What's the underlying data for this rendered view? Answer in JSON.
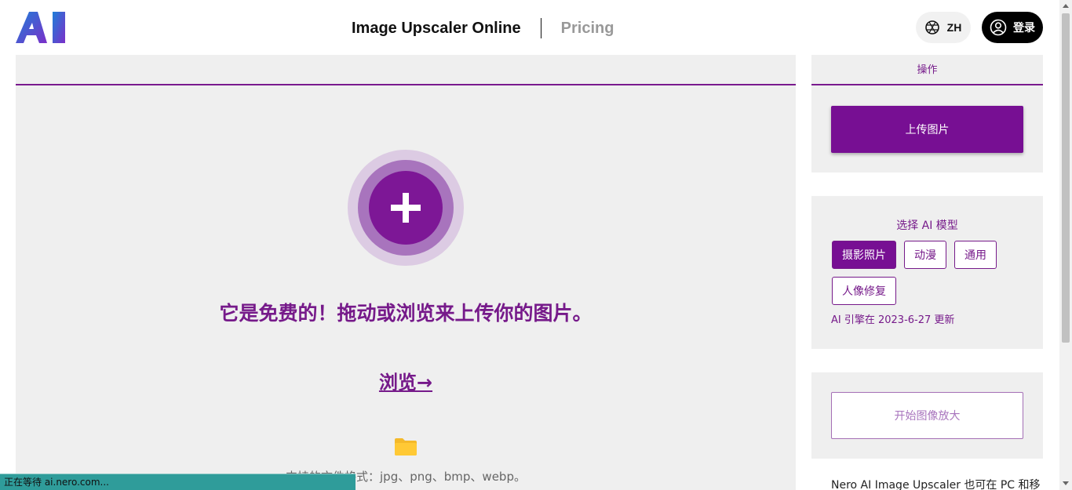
{
  "header": {
    "logo_text": "AI",
    "nav": [
      {
        "label": "Image Upscaler Online"
      },
      {
        "label": "Pricing"
      }
    ],
    "lang_label": "ZH",
    "login_label": "登录"
  },
  "main": {
    "headline": "它是免费的！拖动或浏览来上传你的图片。",
    "browse_label": "浏览→",
    "formats_text": "支持的文件格式：jpg、png、bmp、webp。"
  },
  "sidebar": {
    "actions_title": "操作",
    "upload_label": "上传图片",
    "model_title": "选择 AI 模型",
    "models": [
      {
        "label": "摄影照片",
        "active": true
      },
      {
        "label": "动漫",
        "active": false
      },
      {
        "label": "通用",
        "active": false
      },
      {
        "label": "人像修复",
        "active": false
      }
    ],
    "engine_note": "AI 引擎在 2023-6-27 更新",
    "start_label": "开始图像放大",
    "promo_text": "Nero AI Image Upscaler 也可在 PC 和移"
  },
  "status": {
    "text": "正在等待 ai.nero.com..."
  },
  "colors": {
    "accent": "#770f93",
    "accent_text": "#761a8a",
    "panel_bg": "#efefef",
    "status_bg": "#2f9c9a"
  }
}
